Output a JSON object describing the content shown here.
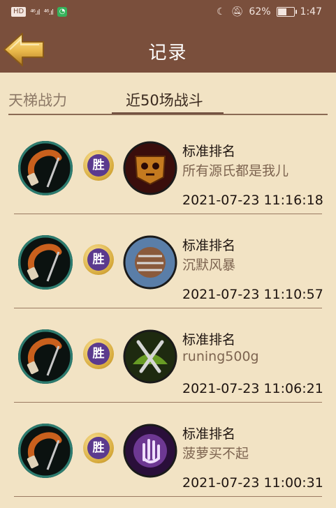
{
  "status_bar": {
    "hd": "HD",
    "signal1": "⁴⁶.ıl",
    "signal2": "⁴⁶.ıl",
    "battery_percent": "62%",
    "battery_level": 0.62,
    "time": "1:47"
  },
  "header": {
    "title": "记录"
  },
  "tabs": [
    {
      "label": "天梯战力",
      "active": false
    },
    {
      "label": "近50场战斗",
      "active": true
    }
  ],
  "records": [
    {
      "result": "胜",
      "mode": "标准排名",
      "opponent": "所有源氏都是我儿",
      "time": "2021-07-23 11:16:18",
      "opponent_icon": "skull-banner-icon"
    },
    {
      "result": "胜",
      "mode": "标准排名",
      "opponent": "沉默风暴",
      "time": "2021-07-23 11:10:57",
      "opponent_icon": "storm-claw-icon"
    },
    {
      "result": "胜",
      "mode": "标准排名",
      "opponent": "runing500g",
      "time": "2021-07-23 11:06:21",
      "opponent_icon": "crossed-daggers-icon"
    },
    {
      "result": "胜",
      "mode": "标准排名",
      "opponent": "菠萝买不起",
      "time": "2021-07-23 11:00:31",
      "opponent_icon": "purple-hand-icon"
    }
  ],
  "colors": {
    "header_bg": "#7a4f3c",
    "page_bg": "#f2e3c4",
    "win_badge": "#5b3a8e",
    "muted_text": "#7d6450"
  }
}
